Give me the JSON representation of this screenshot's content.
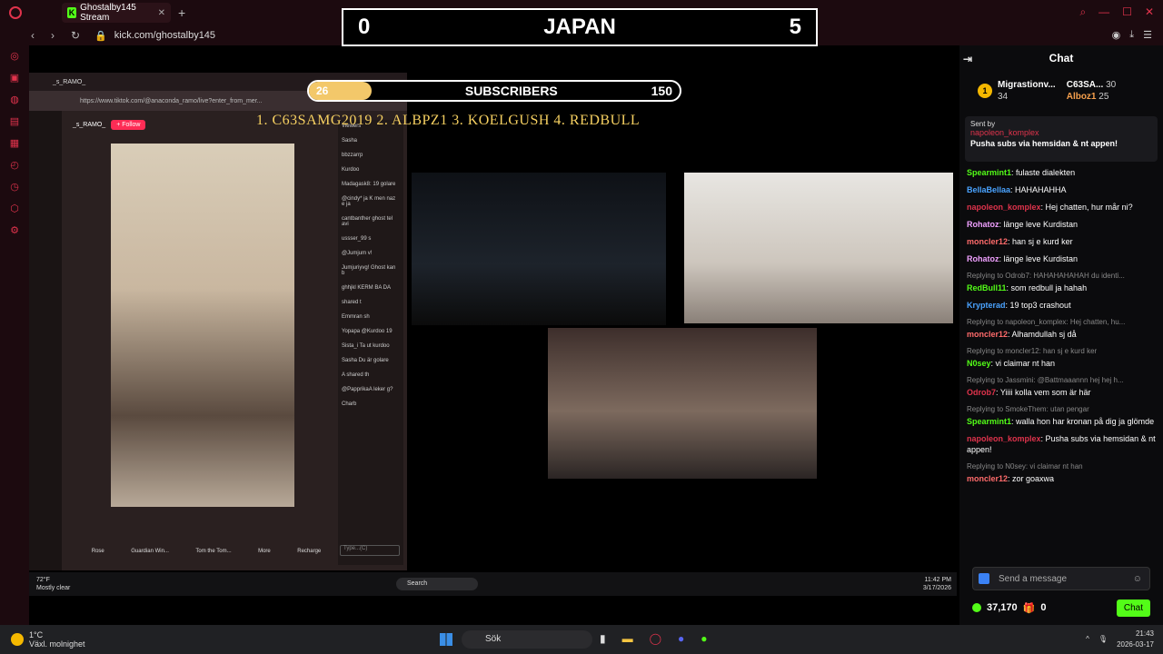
{
  "browser": {
    "tab_title": "Ghostalby145 Stream",
    "url": "kick.com/ghostalby145"
  },
  "score": {
    "left": "0",
    "title": "JAPAN",
    "right": "5"
  },
  "subs_bar": {
    "current": "26",
    "label": "SUBSCRIBERS",
    "goal": "150",
    "progress": 0.173
  },
  "leaders": "1. C63SAMG2019  2. ALBPZ1   3. KOELGUSH  4. REDBULL",
  "inner": {
    "tt_url": "https://www.tiktok.com/@anaconda_ramo/live?enter_from_mer...",
    "tt_user": "_s_RAMO_",
    "follow": "+ Follow",
    "viewers_label": "Viewers",
    "viewers": [
      "Sasha",
      "bbzzarrp",
      "Kurdoo"
    ],
    "tt_chat": [
      "Madagask8: 19 golare",
      "@cindy* ja K men naz e ja",
      "cantbanther ghost tel avi",
      "ussser_99 s",
      "@Jumjum v!",
      "Jumjuriyvg! Ghost kan b",
      "ghhjkl KERM BA DA",
      "shared t",
      "Emmran sh",
      "Yopapa @Kurdoo 19",
      "Sista_i Ta ut kurdoo",
      "Sasha Du är golare",
      "A shared th",
      "@PapprikaA leker g?",
      "Charb"
    ],
    "type_placeholder": "Type...(C)",
    "gifts": [
      {
        "name": "Rose"
      },
      {
        "name": "Guardian Win..."
      },
      {
        "name": "Tom the Tom..."
      },
      {
        "name": "More"
      },
      {
        "name": "Recharge"
      }
    ],
    "weather_temp": "72°F",
    "weather_desc": "Mostly clear",
    "search": "Search",
    "time": "11:42 PM",
    "date": "3/17/2026"
  },
  "chat": {
    "title": "Chat",
    "gifters": [
      {
        "name": "Migrastionv...",
        "count": "34"
      },
      {
        "name": "C63SA...",
        "count": "30"
      },
      {
        "name": "Alboz1",
        "count": "25"
      }
    ],
    "pinned_sent_by": "Sent by",
    "pinned_user": "napoleon_komplex",
    "pinned_text": "Pusha subs via hemsidan & nt appen!",
    "messages": [
      {
        "reply": "",
        "user": "Spearmint1",
        "user_color": "#53fc18",
        "text": ": fulaste dialekten"
      },
      {
        "reply": "",
        "user": "BellaBellaa",
        "user_color": "#4aa3ff",
        "text": ": HAHAHAHHA"
      },
      {
        "reply": "",
        "user": "napoleon_komplex",
        "user_color": "#e0334c",
        "text": ": Hej chatten, hur mår ni?"
      },
      {
        "reply": "",
        "user": "Rohatoz",
        "user_color": "#f0a0ff",
        "text": ": länge leve Kurdistan"
      },
      {
        "reply": "",
        "user": "moncler12",
        "user_color": "#ff6b6b",
        "text": ": han sj e kurd ker"
      },
      {
        "reply": "",
        "user": "Rohatoz",
        "user_color": "#f0a0ff",
        "text": ": länge leve Kurdistan"
      },
      {
        "reply": "Replying to Odrob7: HAHAHAHAHAH du identi...",
        "user": "RedBull11",
        "user_color": "#53fc18",
        "text": ": som redbull ja hahah"
      },
      {
        "reply": "",
        "user": "Krypterad",
        "user_color": "#4aa3ff",
        "text": ": 19 top3 crashout"
      },
      {
        "reply": "Replying to napoleon_komplex: Hej chatten, hu...",
        "user": "moncler12",
        "user_color": "#ff6b6b",
        "text": ": Alhamdullah sj då"
      },
      {
        "reply": "Replying to moncler12: han sj e kurd ker",
        "user": "N0sey",
        "user_color": "#53fc18",
        "text": ": vi claimar nt han"
      },
      {
        "reply": "Replying to Jassmini: @Battmaaannn hej hej h...",
        "user": "Odrob7",
        "user_color": "#e0334c",
        "text": ": Yiiii kolla vem som är här"
      },
      {
        "reply": "Replying to SmokeThem: utan pengar",
        "user": "Spearmint1",
        "user_color": "#53fc18",
        "text": ": walla hon har kronan på dig ja glömde"
      },
      {
        "reply": "",
        "user": "napoleon_komplex",
        "user_color": "#e0334c",
        "text": ": Pusha subs via hemsidan & nt appen!"
      },
      {
        "reply": "Replying to N0sey: vi claimar nt han",
        "user": "moncler12",
        "user_color": "#ff6b6b",
        "text": ": zor goaxwa"
      }
    ],
    "input_placeholder": "Send a message",
    "points": "37,170",
    "gift_count": "0",
    "chat_button": "Chat"
  },
  "taskbar": {
    "temp": "1°C",
    "weather": "Växl. molnighet",
    "search": "Sök",
    "time": "21:43",
    "date": "2026-03-17"
  }
}
